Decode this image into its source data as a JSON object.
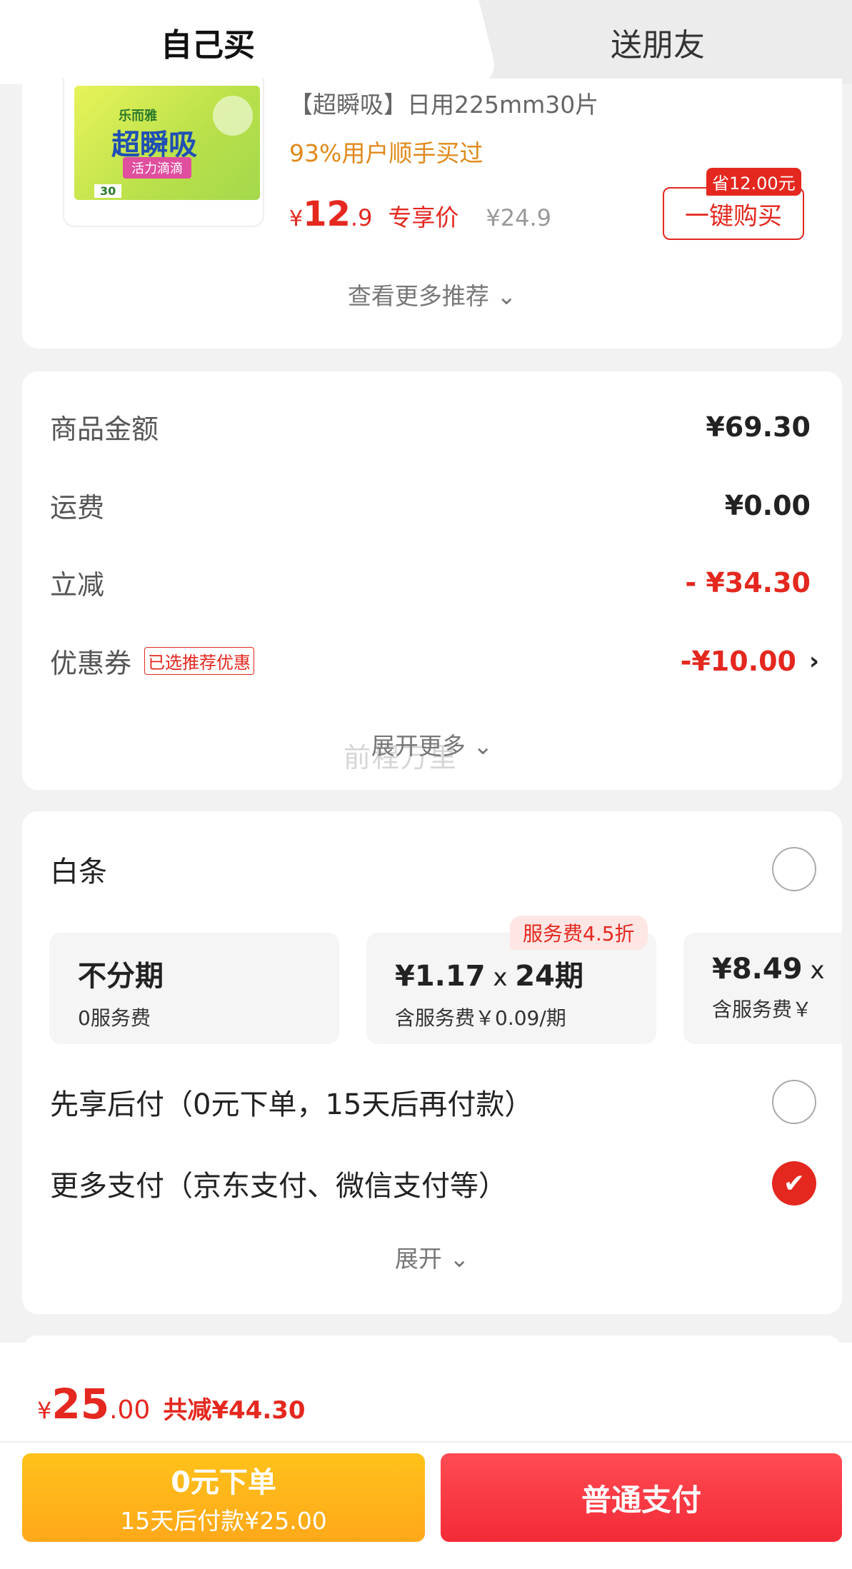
{
  "tabs": {
    "self_buy": "自己买",
    "gift_friend": "送朋友"
  },
  "product": {
    "image_brand": "乐而雅",
    "image_name": "超瞬吸",
    "image_band": "活力滴滴",
    "image_count": "30",
    "title": "【超瞬吸】日用225mm30片",
    "rate": "93%用户顺手买过",
    "price_yen": "¥",
    "price_int": "12",
    "price_dec": ".9",
    "price_tag": "专享价",
    "orig_price": "¥24.9",
    "save_tag": "省12.00元",
    "buy_button": "一键购买",
    "more_rec": "查看更多推荐 ⌄"
  },
  "summary": {
    "goods_label": "商品金额",
    "goods_value": "¥69.30",
    "shipping_label": "运费",
    "shipping_value": "¥0.00",
    "discount_label": "立减",
    "discount_value": "- ¥34.30",
    "coupon_label": "优惠券",
    "coupon_tag": "已选推荐优惠",
    "coupon_value": "-¥10.00",
    "coupon_arrow": "›",
    "expand_more": "展开更多 ⌄",
    "watermark": "前程万里"
  },
  "payment": {
    "baitiao_label": "白条",
    "fee_tag": "服务费4.5折",
    "plans": [
      {
        "main": "不分期",
        "x": "",
        "term": "",
        "sub": "0服务费"
      },
      {
        "main": "¥1.17",
        "x": " x ",
        "term": "24期",
        "sub": "含服务费￥0.09/期"
      },
      {
        "main": "¥8.49",
        "x": " x",
        "term": "",
        "sub": "含服务费￥"
      }
    ],
    "pay_later_label": "先享后付（0元下单，15天后再付款）",
    "more_pay_label": "更多支付（京东支付、微信支付等）",
    "check_mark": "✔",
    "expand": "展开 ⌄"
  },
  "bottom": {
    "total_yen": "¥",
    "total_int": "25",
    "total_dec": ".00",
    "total_less": "共减¥44.30",
    "zero_btn_title": "0元下单",
    "zero_btn_sub": "15天后付款¥25.00",
    "pay_btn": "普通支付"
  },
  "colors": {
    "accent_red": "#e4281f",
    "rate_orange": "#e0891a",
    "zero_btn": "#ffb41a",
    "pay_btn": "#f5323c"
  }
}
